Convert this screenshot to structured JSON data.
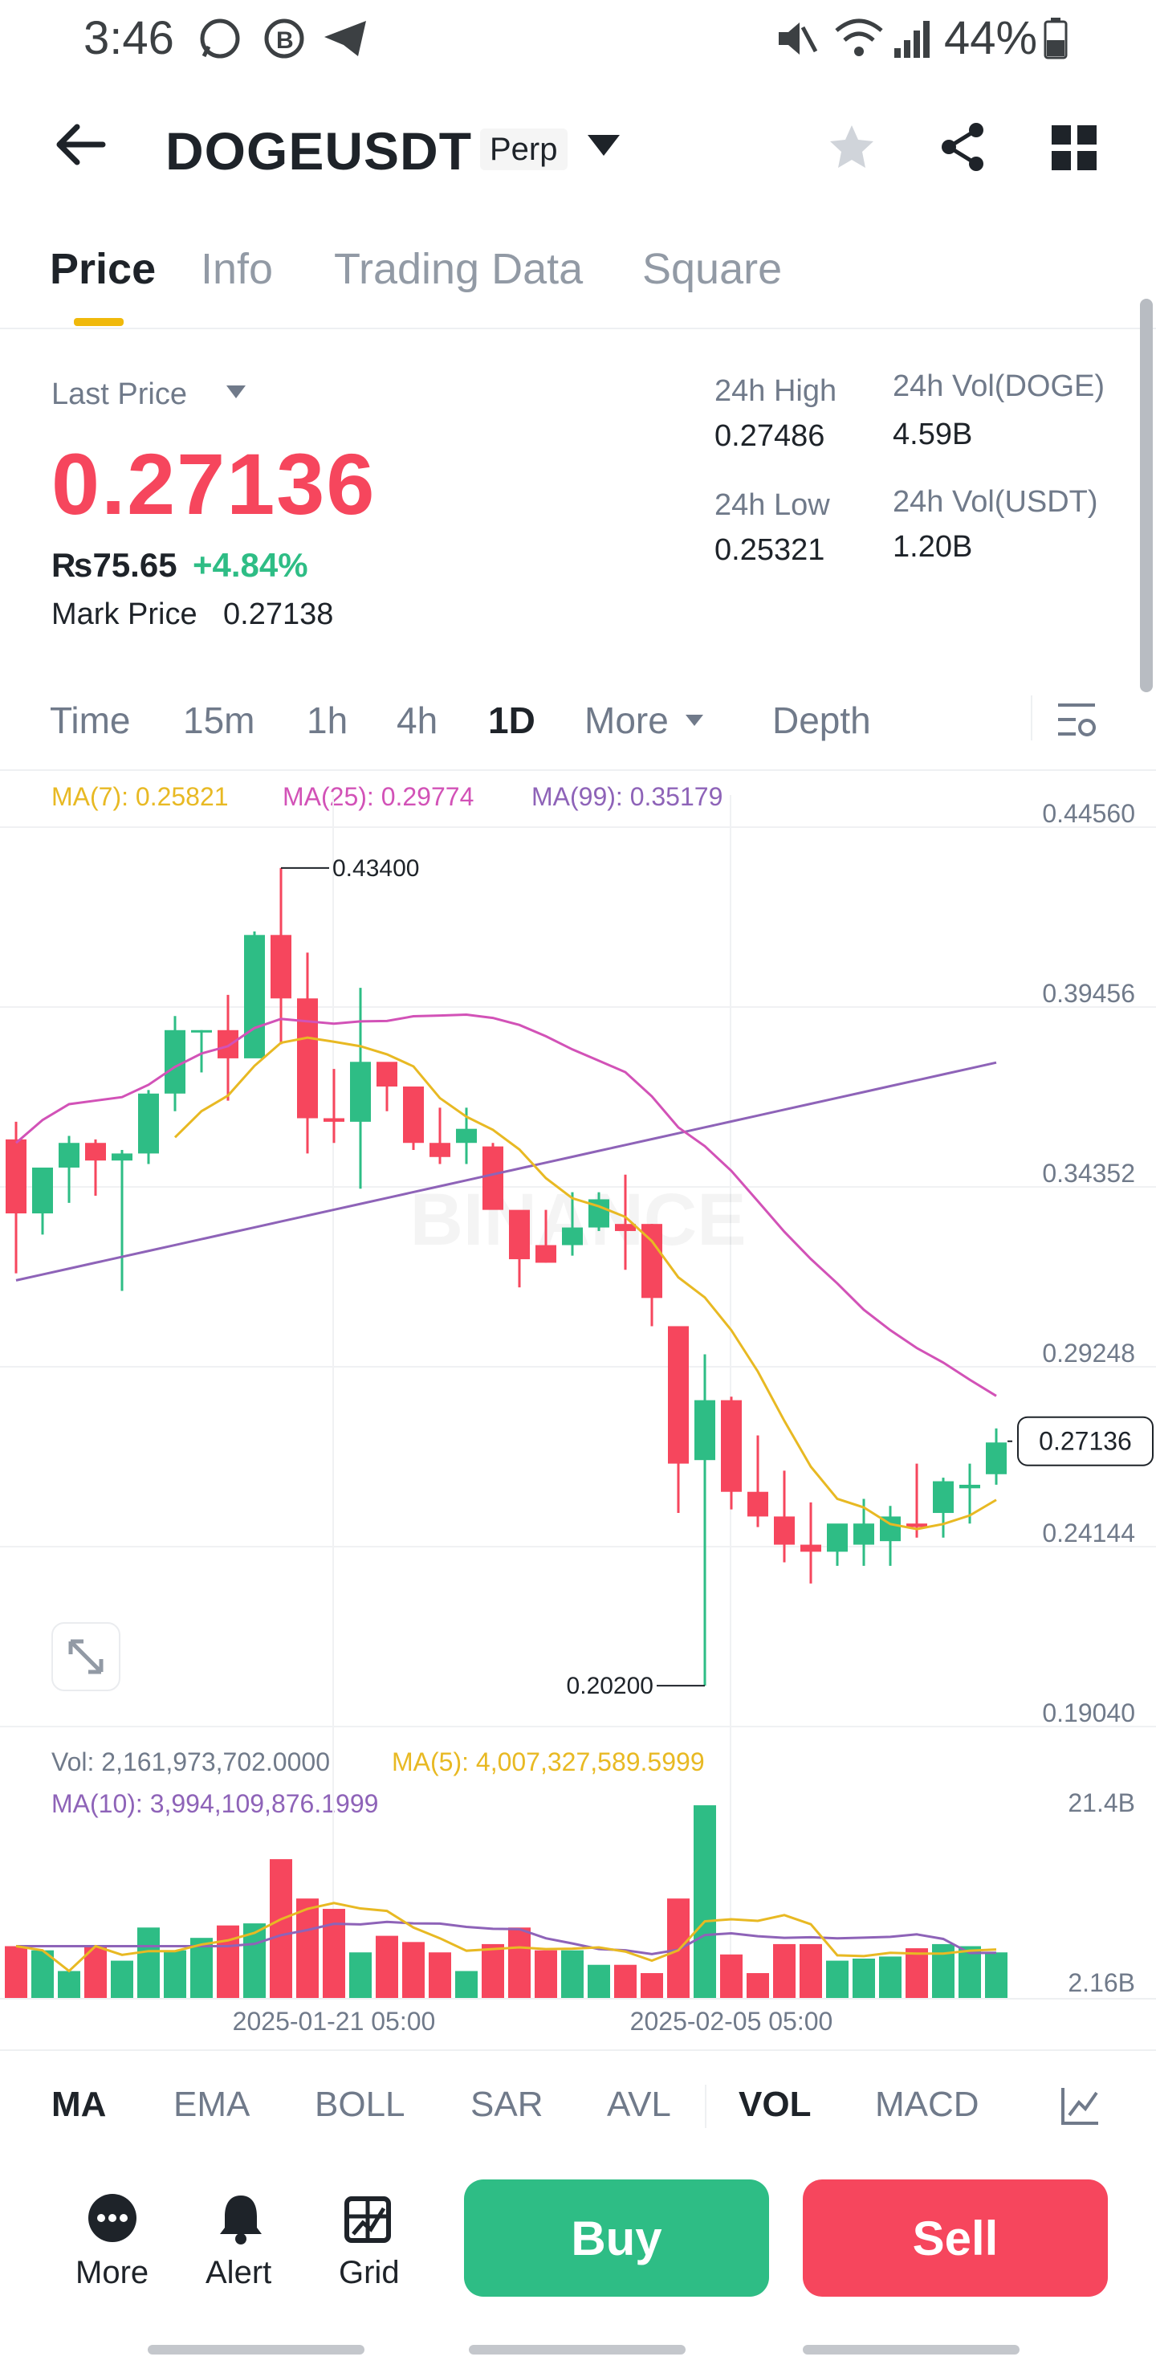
{
  "status_bar": {
    "time": "3:46",
    "battery": "44%"
  },
  "header": {
    "symbol": "DOGEUSDT",
    "contract": "Perp"
  },
  "tabs": [
    "Price",
    "Info",
    "Trading Data",
    "Square"
  ],
  "stats": {
    "last_price_label": "Last Price",
    "last_price": "0.27136",
    "inr_price": "₨75.65",
    "change": "+4.84%",
    "mark_price_label": "Mark Price",
    "mark_price": "0.27138",
    "high_label": "24h High",
    "high": "0.27486",
    "low_label": "24h Low",
    "low": "0.25321",
    "vol_doge_label": "24h Vol(DOGE)",
    "vol_doge": "4.59B",
    "vol_usdt_label": "24h Vol(USDT)",
    "vol_usdt": "1.20B"
  },
  "timeframes": [
    "Time",
    "15m",
    "1h",
    "4h",
    "1D",
    "More",
    "Depth"
  ],
  "ma_legend": {
    "ma7": "MA(7): 0.25821",
    "ma25": "MA(25): 0.29774",
    "ma99": "MA(99): 0.35179"
  },
  "vol_legend": {
    "vol": "Vol: 2,161,973,702.0000",
    "ma5": "MA(5): 4,007,327,589.5999",
    "ma10": "MA(10): 3,994,109,876.1999"
  },
  "indicators": [
    "MA",
    "EMA",
    "BOLL",
    "SAR",
    "AVL",
    "VOL",
    "MACD"
  ],
  "bottom": {
    "more": "More",
    "alert": "Alert",
    "grid": "Grid",
    "buy": "Buy",
    "sell": "Sell"
  },
  "watermark": "BINANCE",
  "chart_data": {
    "type": "candlestick",
    "price_axis_ticks": [
      "0.44560",
      "0.39456",
      "0.34352",
      "0.29248",
      "0.24144",
      "0.19040"
    ],
    "volume_axis_ticks": [
      "21.4B",
      "2.16B"
    ],
    "date_labels": [
      "2025-01-21 05:00",
      "2025-02-05 05:00"
    ],
    "high_marker": "0.43400",
    "low_marker": "0.20200",
    "last_price_tag": "0.27136",
    "colors": {
      "up": "#2ebd85",
      "down": "#f6465d",
      "ma7": "#e8b923",
      "ma25": "#d252b7",
      "ma99": "#8e63b8"
    },
    "candles": [
      {
        "o": 0.357,
        "h": 0.362,
        "l": 0.319,
        "c": 0.336
      },
      {
        "o": 0.336,
        "h": 0.349,
        "l": 0.33,
        "c": 0.349
      },
      {
        "o": 0.349,
        "h": 0.358,
        "l": 0.339,
        "c": 0.356
      },
      {
        "o": 0.356,
        "h": 0.357,
        "l": 0.341,
        "c": 0.351
      },
      {
        "o": 0.351,
        "h": 0.354,
        "l": 0.314,
        "c": 0.353
      },
      {
        "o": 0.353,
        "h": 0.371,
        "l": 0.35,
        "c": 0.37
      },
      {
        "o": 0.37,
        "h": 0.392,
        "l": 0.365,
        "c": 0.388
      },
      {
        "o": 0.388,
        "h": 0.388,
        "l": 0.376,
        "c": 0.388
      },
      {
        "o": 0.388,
        "h": 0.398,
        "l": 0.368,
        "c": 0.38
      },
      {
        "o": 0.38,
        "h": 0.416,
        "l": 0.381,
        "c": 0.415
      },
      {
        "o": 0.415,
        "h": 0.434,
        "l": 0.384,
        "c": 0.397
      },
      {
        "o": 0.397,
        "h": 0.41,
        "l": 0.353,
        "c": 0.363
      },
      {
        "o": 0.363,
        "h": 0.377,
        "l": 0.356,
        "c": 0.362
      },
      {
        "o": 0.362,
        "h": 0.4,
        "l": 0.343,
        "c": 0.379
      },
      {
        "o": 0.379,
        "h": 0.376,
        "l": 0.365,
        "c": 0.372
      },
      {
        "o": 0.372,
        "h": 0.37,
        "l": 0.354,
        "c": 0.356
      },
      {
        "o": 0.356,
        "h": 0.366,
        "l": 0.35,
        "c": 0.352
      },
      {
        "o": 0.356,
        "h": 0.366,
        "l": 0.35,
        "c": 0.36
      },
      {
        "o": 0.355,
        "h": 0.356,
        "l": 0.339,
        "c": 0.337
      },
      {
        "o": 0.337,
        "h": 0.336,
        "l": 0.315,
        "c": 0.323
      },
      {
        "o": 0.327,
        "h": 0.337,
        "l": 0.322,
        "c": 0.322
      },
      {
        "o": 0.327,
        "h": 0.342,
        "l": 0.324,
        "c": 0.332
      },
      {
        "o": 0.332,
        "h": 0.342,
        "l": 0.331,
        "c": 0.34
      },
      {
        "o": 0.333,
        "h": 0.347,
        "l": 0.32,
        "c": 0.331
      },
      {
        "o": 0.333,
        "h": 0.333,
        "l": 0.304,
        "c": 0.312
      },
      {
        "o": 0.304,
        "h": 0.304,
        "l": 0.251,
        "c": 0.265
      },
      {
        "o": 0.266,
        "h": 0.296,
        "l": 0.202,
        "c": 0.283
      },
      {
        "o": 0.283,
        "h": 0.284,
        "l": 0.252,
        "c": 0.257
      },
      {
        "o": 0.257,
        "h": 0.273,
        "l": 0.247,
        "c": 0.25
      },
      {
        "o": 0.25,
        "h": 0.263,
        "l": 0.237,
        "c": 0.242
      },
      {
        "o": 0.242,
        "h": 0.254,
        "l": 0.231,
        "c": 0.24
      },
      {
        "o": 0.24,
        "h": 0.247,
        "l": 0.236,
        "c": 0.248
      },
      {
        "o": 0.242,
        "h": 0.255,
        "l": 0.236,
        "c": 0.248
      },
      {
        "o": 0.243,
        "h": 0.253,
        "l": 0.236,
        "c": 0.25
      },
      {
        "o": 0.248,
        "h": 0.265,
        "l": 0.244,
        "c": 0.247
      },
      {
        "o": 0.251,
        "h": 0.261,
        "l": 0.244,
        "c": 0.26
      },
      {
        "o": 0.258,
        "h": 0.265,
        "l": 0.248,
        "c": 0.259
      },
      {
        "o": 0.262,
        "h": 0.275,
        "l": 0.259,
        "c": 0.271
      }
    ],
    "volumes": [
      2.5,
      2.3,
      1.3,
      2.5,
      1.8,
      3.4,
      2.3,
      2.9,
      3.5,
      3.6,
      6.7,
      4.8,
      4.3,
      2.2,
      3.0,
      2.7,
      2.2,
      1.3,
      2.6,
      3.4,
      2.3,
      2.3,
      1.6,
      1.6,
      1.2,
      4.8,
      9.3,
      2.1,
      1.2,
      2.6,
      2.6,
      1.8,
      1.9,
      2.0,
      2.4,
      2.6,
      2.5,
      2.2
    ]
  }
}
